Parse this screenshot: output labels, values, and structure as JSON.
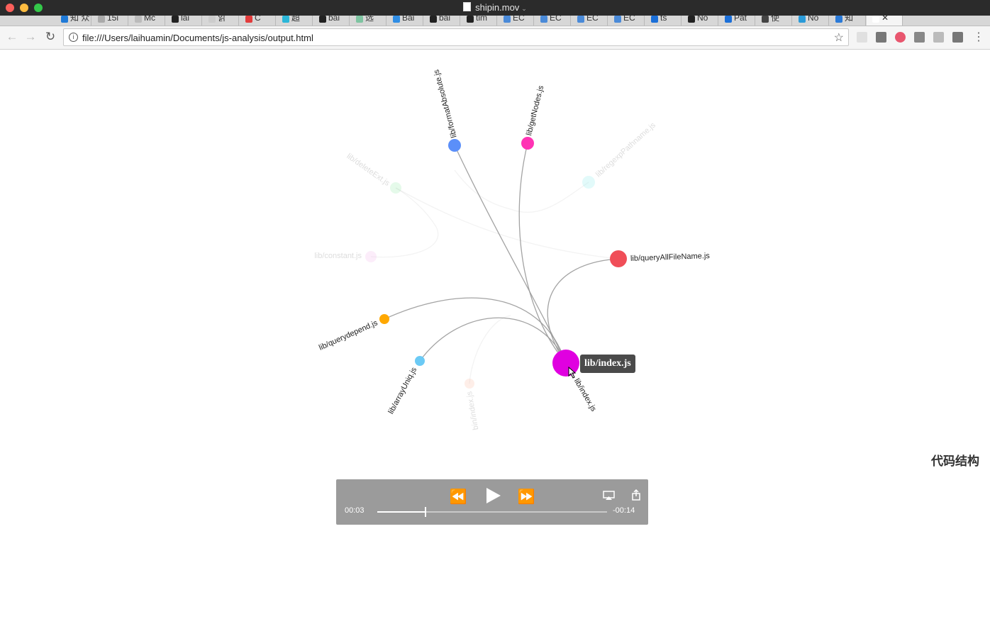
{
  "window": {
    "title": "shipin.mov",
    "caret": "⌄"
  },
  "browser": {
    "tabs": [
      {
        "label": "知 众",
        "color": "#1f7ad7"
      },
      {
        "label": "15i",
        "color": "#aaaaaa"
      },
      {
        "label": "Mc",
        "color": "#bbbbbb"
      },
      {
        "label": "lai",
        "color": "#222222"
      },
      {
        "label": "읽",
        "color": "#cccccc"
      },
      {
        "label": "C",
        "color": "#e23b3b"
      },
      {
        "label": "超",
        "color": "#2bb6d8"
      },
      {
        "label": "bai",
        "color": "#222222"
      },
      {
        "label": "选",
        "color": "#7ec4a1"
      },
      {
        "label": "Bai",
        "color": "#2f8de4"
      },
      {
        "label": "bai",
        "color": "#222222"
      },
      {
        "label": "tim",
        "color": "#222222"
      },
      {
        "label": "EC",
        "color": "#4a8ad8"
      },
      {
        "label": "EC",
        "color": "#4a8ad8"
      },
      {
        "label": "EC",
        "color": "#4a8ad8"
      },
      {
        "label": "EC",
        "color": "#4a8ad8"
      },
      {
        "label": "ts",
        "color": "#1b6fd8"
      },
      {
        "label": "No",
        "color": "#222222"
      },
      {
        "label": "Pat",
        "color": "#1b6fd8"
      },
      {
        "label": "使",
        "color": "#444444"
      },
      {
        "label": "No",
        "color": "#2a9ad8"
      },
      {
        "label": "知",
        "color": "#2a7ad8"
      },
      {
        "label": "✕",
        "color": "#ffffff"
      }
    ],
    "back_icon": "←",
    "forward_icon": "→",
    "reload_icon": "↻",
    "info_icon": "i",
    "url": "file:///Users/laihuamin/Documents/js-analysis/output.html",
    "star_icon": "☆",
    "extensions": [
      {
        "name": "refresh-ext-icon",
        "color": "#e0e0e0"
      },
      {
        "name": "qr-ext-icon",
        "color": "#777777"
      },
      {
        "name": "red-circle-ext-icon",
        "color": "#e8566e"
      },
      {
        "name": "v-ext-icon",
        "color": "#888888"
      },
      {
        "name": "bird-ext-icon",
        "color": "#bbbbbb"
      },
      {
        "name": "qr2-ext-icon",
        "color": "#777777"
      }
    ],
    "menu_icon": "⋮"
  },
  "graph": {
    "tooltip": "lib/index.js",
    "side_title": "代码结构",
    "center_node": {
      "label": "lib/index.js",
      "color": "#e000e0"
    },
    "nodes": [
      {
        "label": "lib/formatAbsolute.js",
        "color": "#5b8ff9",
        "faded": false
      },
      {
        "label": "lib/getNodes.js",
        "color": "#ff33b4",
        "faded": false
      },
      {
        "label": "lib/regexpPathname.js",
        "color": "#9ff0f0",
        "faded": true
      },
      {
        "label": "lib/deleteExt.js",
        "color": "#aaf0bb",
        "faded": true
      },
      {
        "label": "lib/constant.js",
        "color": "#f6c3f0",
        "faded": true
      },
      {
        "label": "lib/queryAllFileName.js",
        "color": "#f04e58",
        "faded": false
      },
      {
        "label": "lib/querydepend.js",
        "color": "#ffa800",
        "faded": false
      },
      {
        "label": "lib/arrayUniq.js",
        "color": "#6bcaf5",
        "faded": false
      },
      {
        "label": "bin/index.js",
        "color": "#fbc8b4",
        "faded": true
      }
    ]
  },
  "player": {
    "rewind_icon": "⏪",
    "play_icon": "▶",
    "forward_icon": "⏩",
    "airplay_icon": "airplay",
    "share_icon": "share",
    "elapsed": "00:03",
    "remaining": "-00:14",
    "progress": 0.21
  }
}
